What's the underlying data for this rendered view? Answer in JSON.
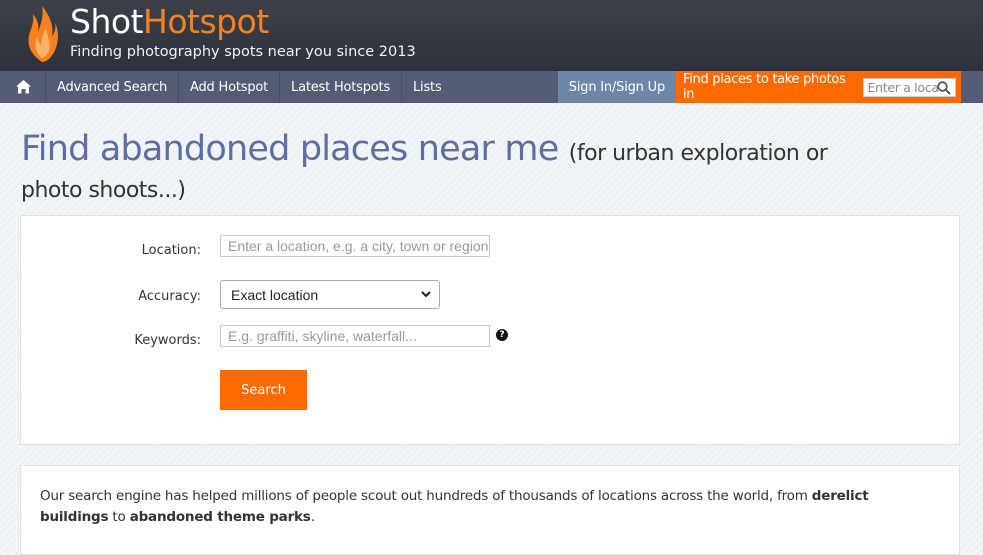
{
  "brand": {
    "name_part1": "Shot",
    "name_part2": "Hotspot",
    "tagline": "Finding photography spots near you since 2013",
    "accent_color": "#f58220"
  },
  "nav": {
    "home_icon": "home-icon",
    "items": [
      {
        "label": "Advanced Search"
      },
      {
        "label": "Add Hotspot"
      },
      {
        "label": "Latest Hotspots"
      },
      {
        "label": "Lists"
      }
    ],
    "sign_in": "Sign In/Sign Up",
    "find_label": "Find places to take photos in",
    "find_placeholder": "Enter a loca",
    "search_icon": "magnifier-icon"
  },
  "page": {
    "title": "Find abandoned places near me",
    "title_sub": "(for urban exploration or",
    "title_line2": "photo shoots...)"
  },
  "form": {
    "location_label": "Location:",
    "location_placeholder": "Enter a location, e.g. a city, town or region",
    "accuracy_label": "Accuracy:",
    "accuracy_value": "Exact location",
    "keywords_label": "Keywords:",
    "keywords_placeholder": "E.g. graffiti, skyline, waterfall...",
    "help_icon": "question-icon",
    "search_button": "Search"
  },
  "info": {
    "text_before": "Our search engine has helped millions of people scout out hundreds of thousands of locations across the world, from ",
    "link1": "derelict buildings",
    "text_mid": " to ",
    "link2": "abandoned theme parks",
    "text_end": "."
  }
}
